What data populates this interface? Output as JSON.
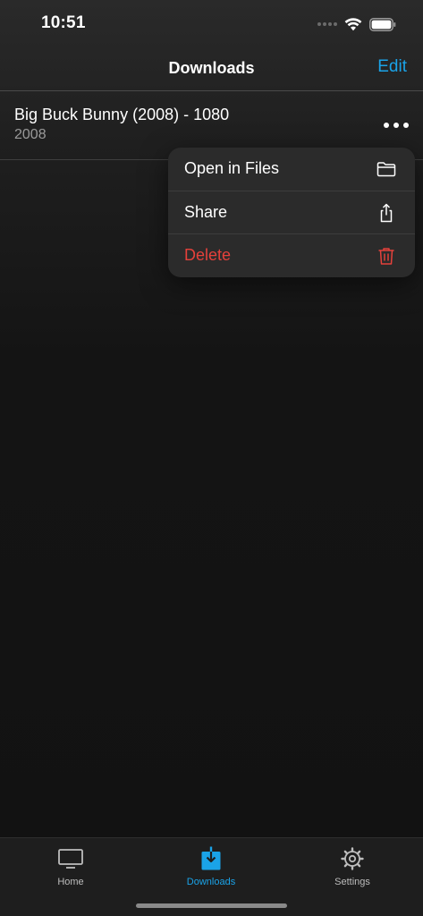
{
  "status_bar": {
    "time": "10:51",
    "icons": [
      "signal-dots-icon",
      "wifi-icon",
      "battery-icon"
    ]
  },
  "nav": {
    "title": "Downloads",
    "edit_label": "Edit"
  },
  "downloads": [
    {
      "title": "Big Buck Bunny (2008) - 1080",
      "subtitle": "2008"
    }
  ],
  "context_menu": {
    "items": [
      {
        "label": "Open in Files",
        "icon": "folder-icon"
      },
      {
        "label": "Share",
        "icon": "share-icon"
      },
      {
        "label": "Delete",
        "icon": "trash-icon"
      }
    ]
  },
  "tab_bar": {
    "items": [
      {
        "label": "Home",
        "icon": "tv-icon",
        "selected": false
      },
      {
        "label": "Downloads",
        "icon": "download-icon",
        "selected": true
      },
      {
        "label": "Settings",
        "icon": "gear-icon",
        "selected": false
      }
    ]
  },
  "colors": {
    "accent": "#1aa3e8",
    "danger": "#e5413b",
    "background": "#121212",
    "menu_background": "#2b2b2b"
  }
}
